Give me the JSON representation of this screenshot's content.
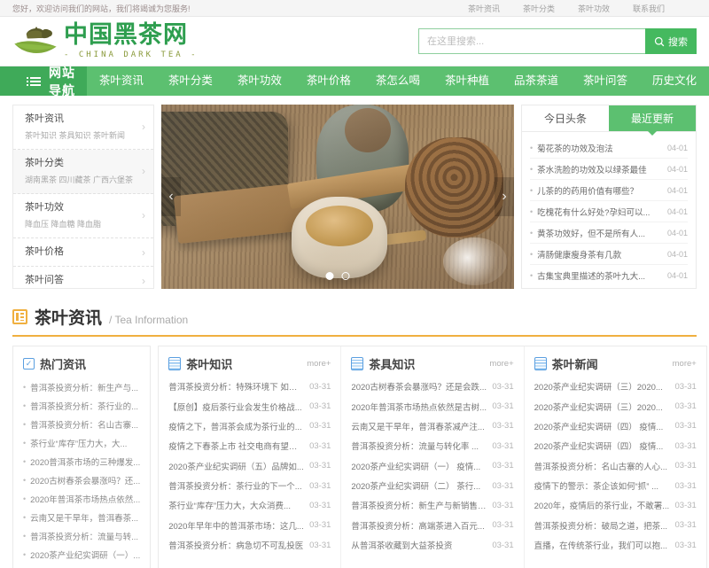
{
  "topbar": {
    "welcome": "您好，欢迎访问我们的网站，我们将竭诚为您服务!",
    "links": [
      {
        "label": "茶叶资讯"
      },
      {
        "label": "茶叶分类"
      },
      {
        "label": "茶叶功效"
      },
      {
        "label": "联系我们"
      }
    ]
  },
  "brand": {
    "title": "中国黑茶网",
    "subtitle": "- CHINA DARK TEA -"
  },
  "search": {
    "placeholder": "在这里搜索...",
    "value": "",
    "button_label": "搜索",
    "icon": "search-icon"
  },
  "mainnav": {
    "toggle_label": "网站导航",
    "toggle_icon": "hamburger-icon",
    "items": [
      {
        "label": "茶叶资讯"
      },
      {
        "label": "茶叶分类"
      },
      {
        "label": "茶叶功效"
      },
      {
        "label": "茶叶价格"
      },
      {
        "label": "茶怎么喝"
      },
      {
        "label": "茶叶种植"
      },
      {
        "label": "品茶茶道"
      },
      {
        "label": "茶叶问答"
      },
      {
        "label": "历史文化"
      }
    ]
  },
  "categories": [
    {
      "title": "茶叶资讯",
      "subs": "茶叶知识 茶具知识 茶叶新闻"
    },
    {
      "title": "茶叶分类",
      "subs": "湖南黑茶 四川藏茶 广西六堡茶"
    },
    {
      "title": "茶叶功效",
      "subs": "降血压 降血糖 降血脂"
    },
    {
      "title": "茶叶价格",
      "subs": ""
    },
    {
      "title": "茶叶问答",
      "subs": ""
    }
  ],
  "carousel": {
    "prev_label": "‹",
    "next_label": "›",
    "slides": [
      {
        "active": true
      },
      {
        "active": false
      }
    ]
  },
  "newsbox": {
    "tabs": [
      {
        "label": "今日头条",
        "active": false
      },
      {
        "label": "最近更新",
        "active": true
      }
    ],
    "items": [
      {
        "title": "菊花茶的功效及泡法",
        "date": "04-01"
      },
      {
        "title": "茶水洗脸的功效及以绿茶最佳",
        "date": "04-01"
      },
      {
        "title": "儿茶的的药用价值有哪些？",
        "date": "04-01"
      },
      {
        "title": "吃槐花有什么好处?孕妇可以...",
        "date": "04-01"
      },
      {
        "title": "黄茶功效好，但不是所有人...",
        "date": "04-01"
      },
      {
        "title": "清肠健康瘦身茶有几款",
        "date": "04-01"
      },
      {
        "title": "古集宝典里描述的茶叶九大...",
        "date": "04-01"
      }
    ]
  },
  "section": {
    "title": "茶叶资讯",
    "subtitle": "/ Tea Information",
    "icon": "article-icon"
  },
  "hotbox": {
    "title": "热门资讯",
    "icon": "check-box-icon",
    "items": [
      {
        "title": "普洱茶投资分析：新生产与..."
      },
      {
        "title": "普洱茶投资分析：茶行业的..."
      },
      {
        "title": "普洱茶投资分析：名山古寨..."
      },
      {
        "title": "茶行业“库存”压力大，大..."
      },
      {
        "title": "2020普洱茶市场的三种爆发..."
      },
      {
        "title": "2020古树春茶会暴涨吗？还..."
      },
      {
        "title": "2020年普洱茶市场热点依然..."
      },
      {
        "title": "云南又是干旱年，普洱春茶..."
      },
      {
        "title": "普洱茶投资分析：流量与转..."
      },
      {
        "title": "2020茶产业纪实调研（一）..."
      }
    ]
  },
  "columns": [
    {
      "title": "茶叶知识",
      "icon": "document-icon",
      "more_label": "more+",
      "items": [
        {
          "title": "普洱茶投资分析：特殊环境下 如何...",
          "date": "03-31"
        },
        {
          "title": "【原创】疫后茶行业会发生价格战...",
          "date": "03-31"
        },
        {
          "title": "疫情之下，普洱茶会成为茶行业的...",
          "date": "03-31"
        },
        {
          "title": "疫情之下春茶上市 社交电商有望助...",
          "date": "03-31"
        },
        {
          "title": "2020茶产业纪实调研（五）品牌如...",
          "date": "03-31"
        },
        {
          "title": "普洱茶投资分析：茶行业的下一个...",
          "date": "03-31"
        },
        {
          "title": "茶行业“库存”压力大，大众消费...",
          "date": "03-31"
        },
        {
          "title": "2020年早年中的普洱茶市场：这几...",
          "date": "03-31"
        },
        {
          "title": "普洱茶投资分析：病急切不可乱投医",
          "date": "03-31"
        }
      ]
    },
    {
      "title": "茶具知识",
      "icon": "document-icon",
      "more_label": "more+",
      "items": [
        {
          "title": "2020古树春茶会暴涨吗？还是会跌...",
          "date": "03-31"
        },
        {
          "title": "2020年普洱茶市场热点依然是古树...",
          "date": "03-31"
        },
        {
          "title": "云南又是干旱年，普洱春茶减产注...",
          "date": "03-31"
        },
        {
          "title": "普洱茶投资分析：流量与转化率 ...",
          "date": "03-31"
        },
        {
          "title": "2020茶产业纪实调研（一） 疫情...",
          "date": "03-31"
        },
        {
          "title": "2020茶产业纪实调研（二） 茶行...",
          "date": "03-31"
        },
        {
          "title": "普洱茶投资分析：新生产与新销售 ...",
          "date": "03-31"
        },
        {
          "title": "普洱茶投资分析：高端茶进入百元...",
          "date": "03-31"
        },
        {
          "title": "从普洱茶收藏到大益茶投资",
          "date": "03-31"
        }
      ]
    },
    {
      "title": "茶叶新闻",
      "icon": "document-icon",
      "more_label": "more+",
      "items": [
        {
          "title": "2020茶产业纪实调研（三）2020...",
          "date": "03-31"
        },
        {
          "title": "2020茶产业纪实调研（三）2020...",
          "date": "03-31"
        },
        {
          "title": "2020茶产业纪实调研（四） 疫情...",
          "date": "03-31"
        },
        {
          "title": "2020茶产业纪实调研（四） 疫情...",
          "date": "03-31"
        },
        {
          "title": "普洱茶投资分析：名山古寨的人心...",
          "date": "03-31"
        },
        {
          "title": "疫情下的警示：茶企该如何“抓” ...",
          "date": "03-31"
        },
        {
          "title": "2020年，疫情后的茶行业，不敢署...",
          "date": "03-31"
        },
        {
          "title": "普洱茶投资分析：破局之道，把茶...",
          "date": "03-31"
        },
        {
          "title": "直播，在传统茶行业，我们可以抱...",
          "date": "03-31"
        }
      ]
    }
  ],
  "colors": {
    "brand_green": "#2e9e4f",
    "nav_green": "#5cc070",
    "nav_green_dark": "#3faa59",
    "accent_orange": "#f0b040",
    "icon_blue": "#5a9fe0"
  }
}
